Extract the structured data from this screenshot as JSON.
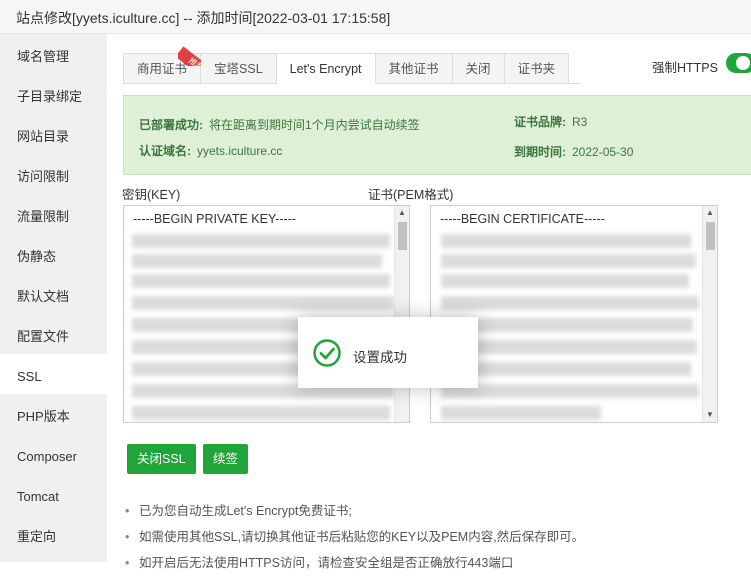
{
  "window": {
    "title": "站点修改[yyets.iculture.cc] -- 添加时间[2022-03-01 17:15:58]"
  },
  "sidebar": {
    "items": [
      {
        "label": "域名管理"
      },
      {
        "label": "子目录绑定"
      },
      {
        "label": "网站目录"
      },
      {
        "label": "访问限制"
      },
      {
        "label": "流量限制"
      },
      {
        "label": "伪静态"
      },
      {
        "label": "默认文档"
      },
      {
        "label": "配置文件"
      },
      {
        "label": "SSL"
      },
      {
        "label": "PHP版本"
      },
      {
        "label": "Composer"
      },
      {
        "label": "Tomcat"
      },
      {
        "label": "重定向"
      }
    ]
  },
  "tabs": [
    {
      "label": "商用证书",
      "badge": "推荐"
    },
    {
      "label": "宝塔SSL"
    },
    {
      "label": "Let's Encrypt"
    },
    {
      "label": "其他证书"
    },
    {
      "label": "关闭"
    },
    {
      "label": "证书夹"
    }
  ],
  "force_https": {
    "label": "强制HTTPS",
    "enabled": true
  },
  "status": {
    "deployed_label": "已部署成功:",
    "deployed_text": "将在距离到期时间1个月内尝试自动续签",
    "domain_label": "认证域名:",
    "domain_value": "yyets.iculture.cc",
    "brand_label": "证书品牌:",
    "brand_value": "R3",
    "expiry_label": "到期时间:",
    "expiry_value": "2022-05-30"
  },
  "key_field": {
    "label": "密钥(KEY)",
    "first_line": "-----BEGIN PRIVATE KEY-----"
  },
  "cert_field": {
    "label": "证书(PEM格式)",
    "first_line": "-----BEGIN CERTIFICATE-----"
  },
  "buttons": {
    "close_ssl": "关闭SSL",
    "renew": "续签"
  },
  "tips": [
    "已为您自动生成Let's Encrypt免费证书;",
    "如需使用其他SSL,请切换其他证书后粘贴您的KEY以及PEM内容,然后保存即可。",
    "如开启后无法使用HTTPS访问，请检查安全组是否正确放行443端口"
  ],
  "toast": {
    "message": "设置成功"
  },
  "colors": {
    "accent": "#20a53a",
    "info_bg": "#dff0d8",
    "info_text": "#3c763d",
    "ribbon": "#e04040"
  }
}
